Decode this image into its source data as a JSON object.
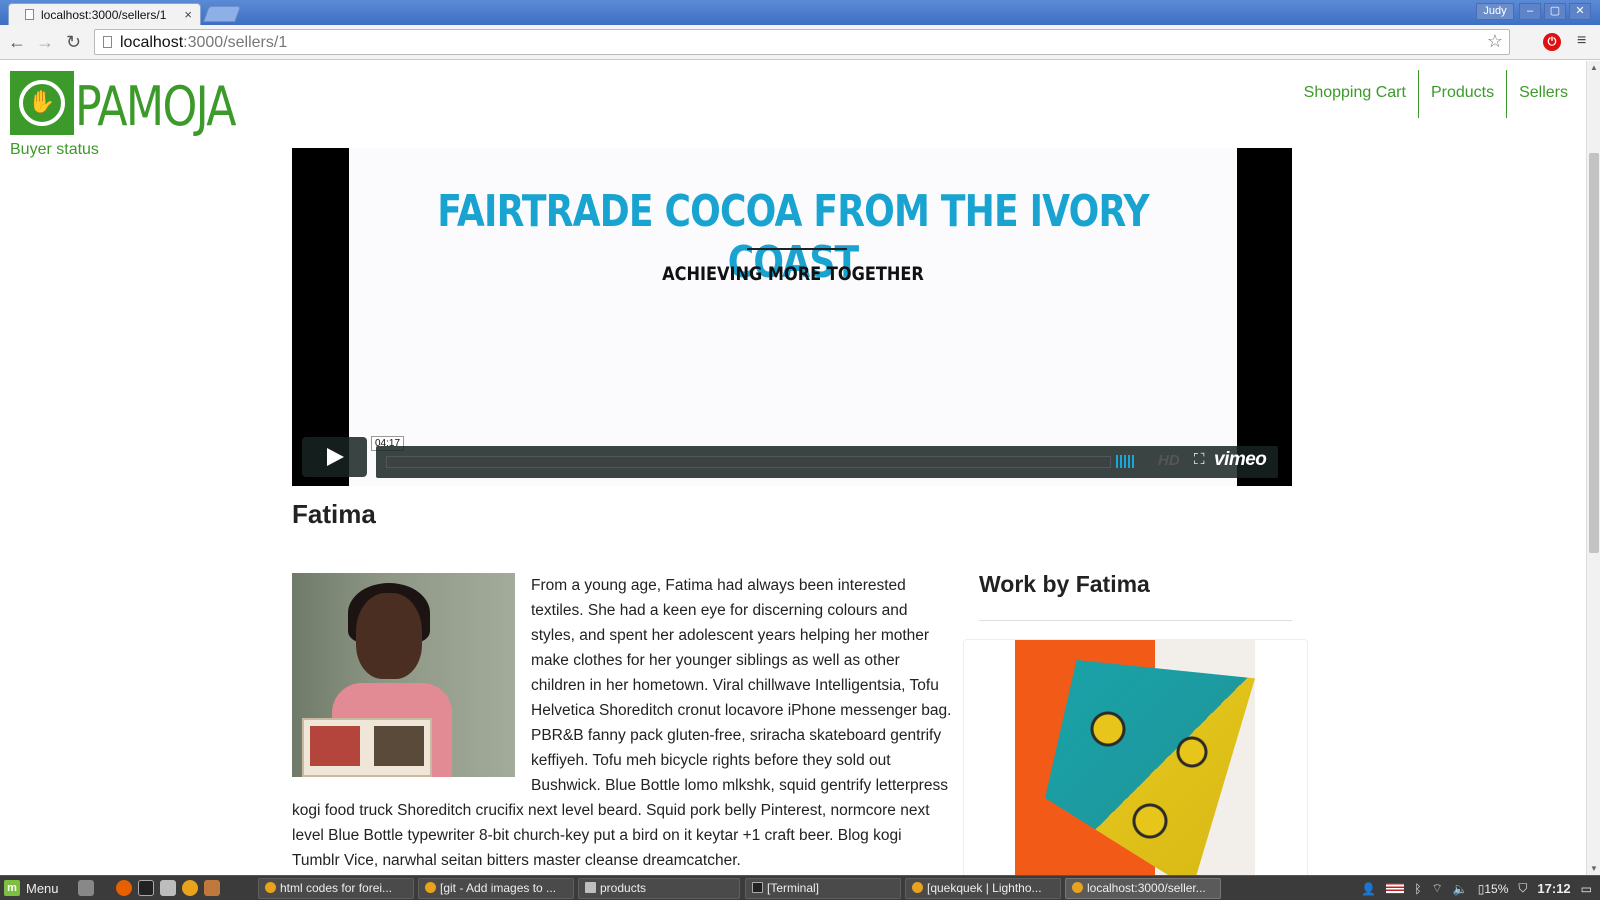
{
  "browser": {
    "tab_title": "localhost:3000/sellers/1",
    "tab_close": "×",
    "user_badge": "Judy",
    "window_buttons": [
      "–",
      "▢",
      "✕"
    ],
    "nav": {
      "back": "←",
      "forward": "→",
      "reload": "↻"
    },
    "url_host": "localhost",
    "url_path": ":3000/sellers/1",
    "star": "☆",
    "ext_label": "⏻",
    "menu": "≡"
  },
  "site": {
    "logo_text": "PAMOJA",
    "buyer_status": "Buyer status",
    "nav": [
      "Shopping Cart",
      "Products",
      "Sellers"
    ],
    "accent_color": "#3c9a2a"
  },
  "video": {
    "headline": "FAIRTRADE COCOA FROM THE IVORY COAST",
    "subhead": "ACHIEVING MORE TOGETHER",
    "duration": "04:17",
    "hd_label": "HD",
    "brand": "vimeo",
    "fullscreen": "⛶"
  },
  "seller": {
    "name": "Fatima",
    "bio": "From a young age, Fatima had always been interested textiles. She had a keen eye for discerning colours and styles, and spent her adolescent years helping her mother make clothes for her younger siblings as well as other children in her hometown. Viral chillwave Intelligentsia, Tofu Helvetica Shoreditch cronut locavore iPhone messenger bag. PBR&B fanny pack gluten-free, sriracha skateboard gentrify keffiyeh. Tofu meh bicycle rights before they sold out Bushwick. Blue Bottle lomo mlkshk, squid gentrify letterpress kogi food truck Shoreditch crucifix next level beard. Squid pork belly Pinterest, normcore next level Blue Bottle typewriter 8-bit church-key put a bird on it keytar +1 craft beer. Blog kogi Tumblr Vice, narwhal seitan bitters master cleanse dreamcatcher.",
    "work_title": "Work by Fatima"
  },
  "taskbar": {
    "menu_label": "Menu",
    "items": [
      "html codes for forei...",
      "[git - Add images to ...",
      "products",
      "[Terminal]",
      "[quekquek | Lightho...",
      "localhost:3000/seller..."
    ],
    "battery": "15%",
    "clock": "17:12"
  }
}
